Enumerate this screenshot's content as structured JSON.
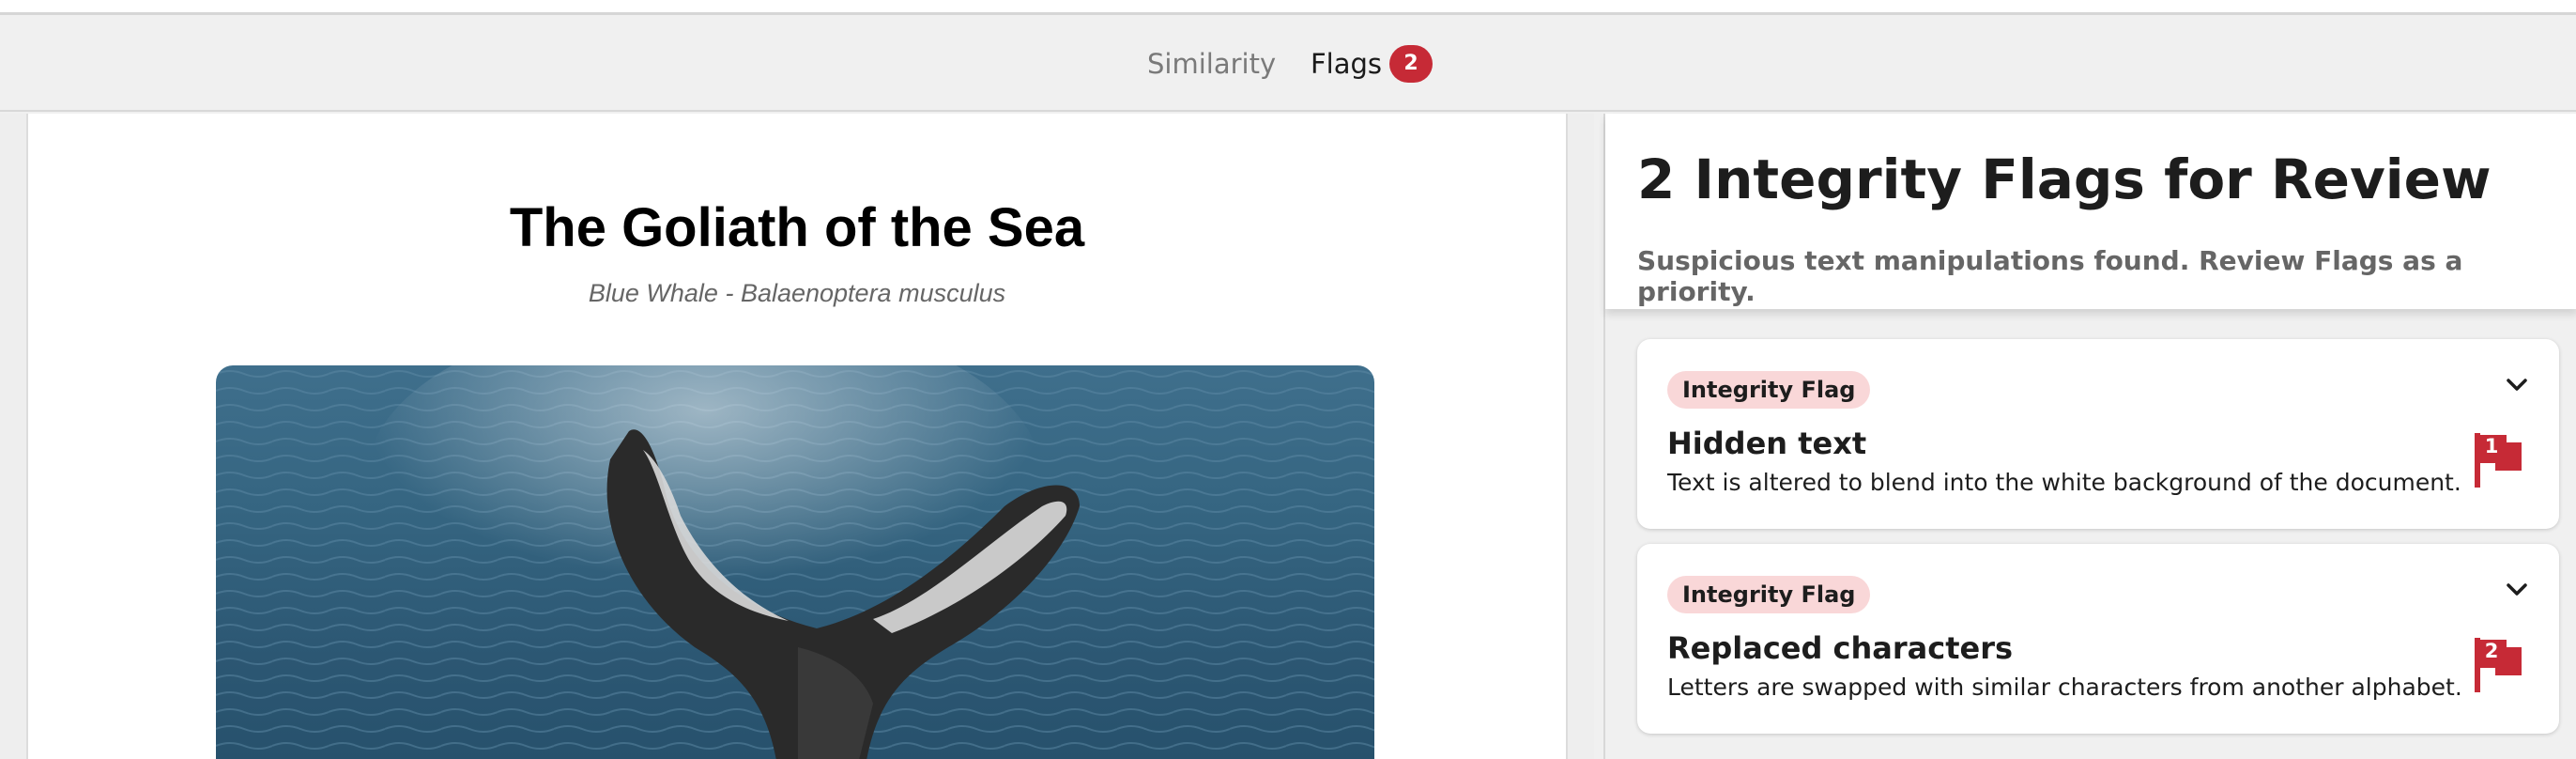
{
  "tabs": {
    "similarity_label": "Similarity",
    "flags_label": "Flags",
    "flags_count": "2"
  },
  "document": {
    "title": "The Goliath of the Sea",
    "subtitle": "Blue Whale - Balaenoptera musculus",
    "image_icon": "whale-tail-photo"
  },
  "review": {
    "title": "2 Integrity Flags for Review",
    "subtitle": "Suspicious text manipulations found. Review Flags as a priority.",
    "flags": [
      {
        "tag": "Integrity Flag",
        "title": "Hidden text",
        "description": "Text is altered to blend into the white background of the document.",
        "number": "1"
      },
      {
        "tag": "Integrity Flag",
        "title": "Replaced characters",
        "description": "Letters are swapped with similar characters from another alphabet.",
        "number": "2"
      }
    ]
  },
  "colors": {
    "accent_blue": "#3d86e0",
    "flag_red": "#c62a36",
    "tag_pink": "#f9d7d8"
  }
}
